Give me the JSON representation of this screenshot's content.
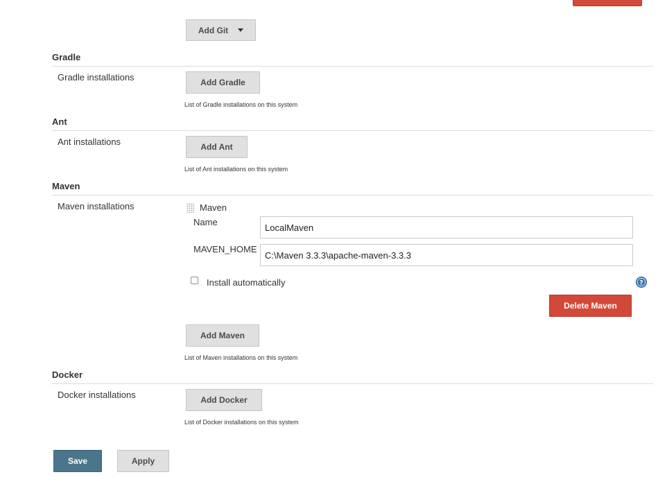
{
  "top_button": {
    "label": ""
  },
  "git": {
    "add_label": "Add Git"
  },
  "gradle": {
    "title": "Gradle",
    "field_label": "Gradle installations",
    "add_label": "Add Gradle",
    "help": "List of Gradle installations on this system"
  },
  "ant": {
    "title": "Ant",
    "field_label": "Ant installations",
    "add_label": "Add Ant",
    "help": "List of Ant installations on this system"
  },
  "maven": {
    "title": "Maven",
    "field_label": "Maven installations",
    "entry_header": "Maven",
    "name_label": "Name",
    "name_value": "LocalMaven",
    "home_label": "MAVEN_HOME",
    "home_value": "C:\\Maven 3.3.3\\apache-maven-3.3.3",
    "install_auto_label": "Install automatically",
    "install_auto_checked": false,
    "delete_label": "Delete Maven",
    "add_label": "Add Maven",
    "help": "List of Maven installations on this system"
  },
  "docker": {
    "title": "Docker",
    "field_label": "Docker installations",
    "add_label": "Add Docker",
    "help": "List of Docker installations on this system"
  },
  "footer": {
    "save_label": "Save",
    "apply_label": "Apply"
  },
  "colors": {
    "danger": "#d24939",
    "primary": "#4b758b",
    "button_bg": "#e0e0e0",
    "help_icon": "#3a76b5"
  },
  "icons": {
    "help": "question-circle-icon",
    "drag": "drag-handle-icon",
    "dropdown": "caret-down-icon"
  }
}
